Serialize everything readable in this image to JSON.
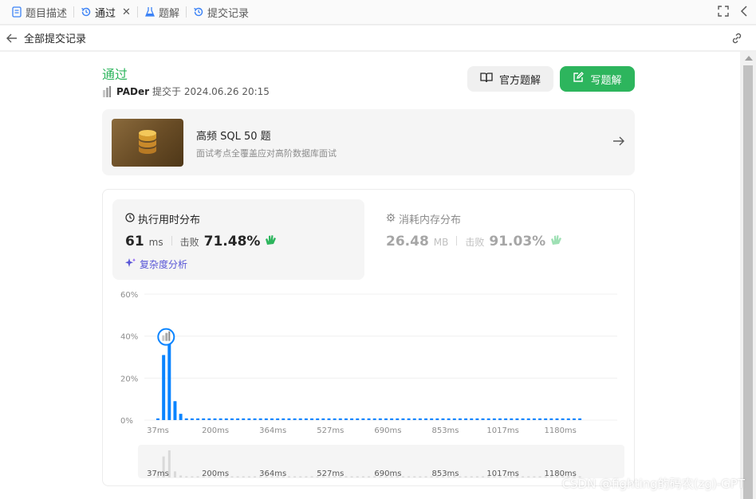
{
  "tabs": [
    {
      "label": "题目描述",
      "icon": "doc-icon",
      "active": false
    },
    {
      "label": "通过",
      "icon": "history-icon",
      "active": true
    },
    {
      "label": "题解",
      "icon": "flask-icon",
      "active": false
    },
    {
      "label": "提交记录",
      "icon": "history-icon",
      "active": false
    }
  ],
  "subbar": {
    "back_label": "全部提交记录"
  },
  "result": {
    "status": "通过",
    "submitter": "PADer",
    "submitted_at": "提交于 2024.06.26 20:15"
  },
  "buttons": {
    "official": "官方题解",
    "write": "写题解"
  },
  "course": {
    "title": "高频 SQL 50 题",
    "subtitle": "面试考点全覆盖应对高阶数据库面试"
  },
  "runtime": {
    "title": "执行用时分布",
    "value": "61",
    "unit": "ms",
    "beat_label": "击败",
    "beat_value": "71.48%",
    "complexity_label": "复杂度分析"
  },
  "memory": {
    "title": "消耗内存分布",
    "value": "26.48",
    "unit": "MB",
    "beat_label": "击败",
    "beat_value": "91.03%"
  },
  "colors": {
    "accent_green": "#2db55d",
    "bar_blue": "#0a84ff",
    "complexity_purple": "#5856d6"
  },
  "chart_data": {
    "type": "bar",
    "ytick_labels": [
      "60%",
      "40%",
      "20%",
      "0%"
    ],
    "ylim": [
      0,
      60
    ],
    "xtick_labels": [
      "37ms",
      "200ms",
      "364ms",
      "527ms",
      "690ms",
      "853ms",
      "1017ms",
      "1180ms"
    ],
    "bar_values": [
      0.8,
      31,
      40,
      9,
      3,
      0.8,
      0.8,
      0.8,
      0.8,
      0.8,
      0.8,
      0.8,
      0.8,
      0.8,
      0.8,
      0.8,
      0.8,
      0.8,
      0.8,
      0.8,
      0.8,
      0.8,
      0.8,
      0.8,
      0.8,
      0.8,
      0.8,
      0.8,
      0.8,
      0.8,
      0.8,
      0.8,
      0.8,
      0.8,
      0.8,
      0.8,
      0.8,
      0.8,
      0.8,
      0.8,
      0.8,
      0.8,
      0.8,
      0.8,
      0.8,
      0.8,
      0.8,
      0.8,
      0.8,
      0.8,
      0.8,
      0.8,
      0.8,
      0.8,
      0.8,
      0.8,
      0.8,
      0.8,
      0.8,
      0.8,
      0.8,
      0.8,
      0.8,
      0.8,
      0.8,
      0.8,
      0.8,
      0.8,
      0.8,
      0.8,
      0.8,
      0.8,
      0.8,
      0.8,
      0.8
    ],
    "highlight_index": 2,
    "grid": true
  },
  "watermark": "CSDN @fighting的码农(zg)-GPT"
}
